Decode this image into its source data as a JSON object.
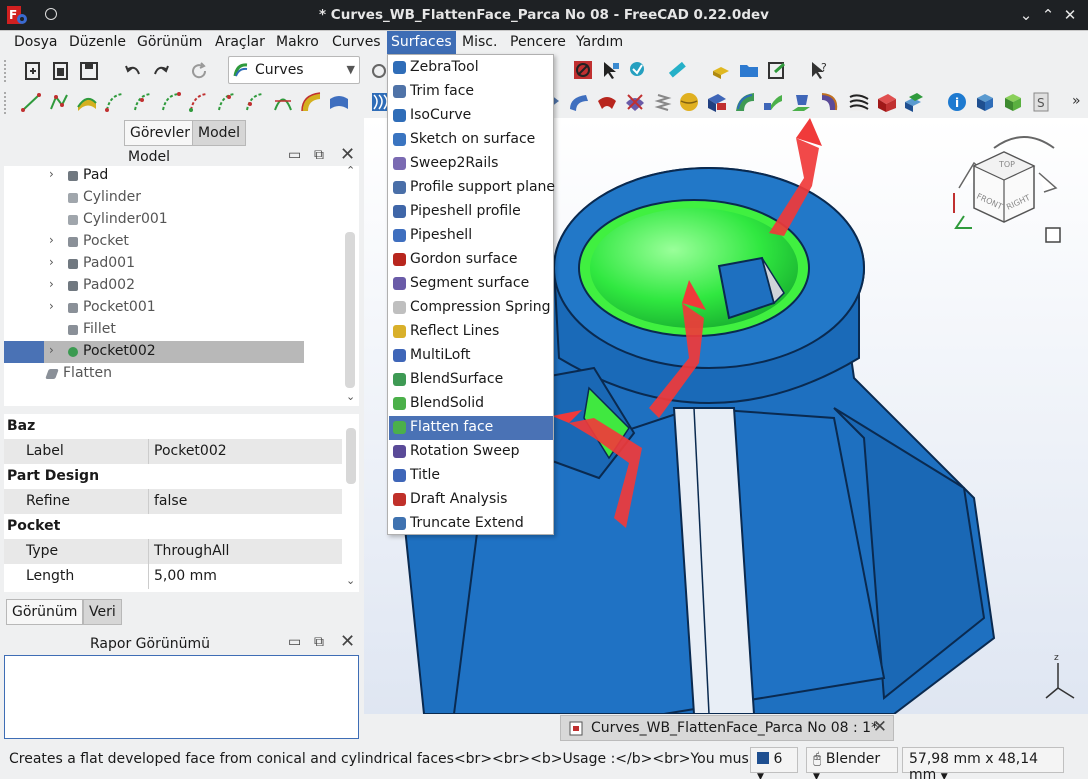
{
  "window": {
    "title": "* Curves_WB_FlattenFace_Parca No 08 - FreeCAD 0.22.0dev",
    "minimize": "⌄",
    "maximize": "⌃",
    "close": "✕"
  },
  "menubar": [
    "Dosya",
    "Düzenle",
    "Görünüm",
    "Araçlar",
    "Makro",
    "Curves",
    "Surfaces",
    "Misc.",
    "Pencere",
    "Yardım"
  ],
  "menubar_active": "Surfaces",
  "workbench_selector": {
    "value": "Curves"
  },
  "surfaces_menu": {
    "items": [
      "ZebraTool",
      "Trim face",
      "IsoCurve",
      "Sketch on surface",
      "Sweep2Rails",
      "Profile support plane",
      "Pipeshell profile",
      "Pipeshell",
      "Gordon surface",
      "Segment surface",
      "Compression Spring",
      "Reflect Lines",
      "MultiLoft",
      "BlendSurface",
      "BlendSolid",
      "Flatten face",
      "Rotation Sweep",
      "Title",
      "Draft Analysis",
      "Truncate Extend"
    ],
    "highlighted": "Flatten face",
    "icon_colors": [
      "#2f6db8",
      "#4f73a8",
      "#2f6db8",
      "#3a74c0",
      "#7a6ab2",
      "#4a6fa8",
      "#3f66a8",
      "#3f6fbf",
      "#b8261e",
      "#6a5ba8",
      "#bfbfbf",
      "#d9b02a",
      "#3f66b8",
      "#3e9a54",
      "#4bb04a",
      "#4bb04a",
      "#5a4a98",
      "#3f66b8",
      "#c0302a",
      "#3f72b0"
    ]
  },
  "left_panel": {
    "tabs": [
      "Görevler",
      "Model"
    ],
    "active_tab": "Model",
    "tree_header": "Model",
    "tree_items": [
      {
        "label": "Pad",
        "expandable": true,
        "dim": false
      },
      {
        "label": "Cylinder",
        "expandable": false,
        "dim": true
      },
      {
        "label": "Cylinder001",
        "expandable": false,
        "dim": true
      },
      {
        "label": "Pocket",
        "expandable": true,
        "dim": true
      },
      {
        "label": "Pad001",
        "expandable": true,
        "dim": true
      },
      {
        "label": "Pad002",
        "expandable": true,
        "dim": true
      },
      {
        "label": "Pocket001",
        "expandable": true,
        "dim": true
      },
      {
        "label": "Fillet",
        "expandable": false,
        "dim": true
      },
      {
        "label": "Pocket002",
        "expandable": true,
        "dim": false,
        "selected": true
      },
      {
        "label": "Flatten",
        "expandable": false,
        "dim": true,
        "root": true
      }
    ],
    "properties": [
      {
        "group": "Baz"
      },
      {
        "key": "Label",
        "value": "Pocket002"
      },
      {
        "group": "Part Design"
      },
      {
        "key": "Refine",
        "value": "false"
      },
      {
        "group": "Pocket"
      },
      {
        "key": "Type",
        "value": "ThroughAll"
      },
      {
        "key": "Length",
        "value": "5,00 mm"
      }
    ],
    "bottom_tabs": [
      "Görünüm",
      "Veri"
    ],
    "active_bottom_tab": "Veri",
    "report_header": "Rapor Görünümü"
  },
  "document_tab": "Curves_WB_FlattenFace_Parca No 08 : 1*",
  "navcube": [
    "TOP",
    "FRONT",
    "RIGHT"
  ],
  "statusbar": {
    "message": "Creates a flat developed face from conical and cylindrical faces<br><br><b>Usage :</b><br>You must select a conical or cylindrical face",
    "grid_value": "6",
    "nav_style": "Blender",
    "dimensions": "57,98 mm x 48,14 mm"
  },
  "colors": {
    "selection": "#4a72b5",
    "model_blue": "#1e70c0",
    "highlight_green": "#3ef03a",
    "arrow_red": "#f03a3a"
  }
}
